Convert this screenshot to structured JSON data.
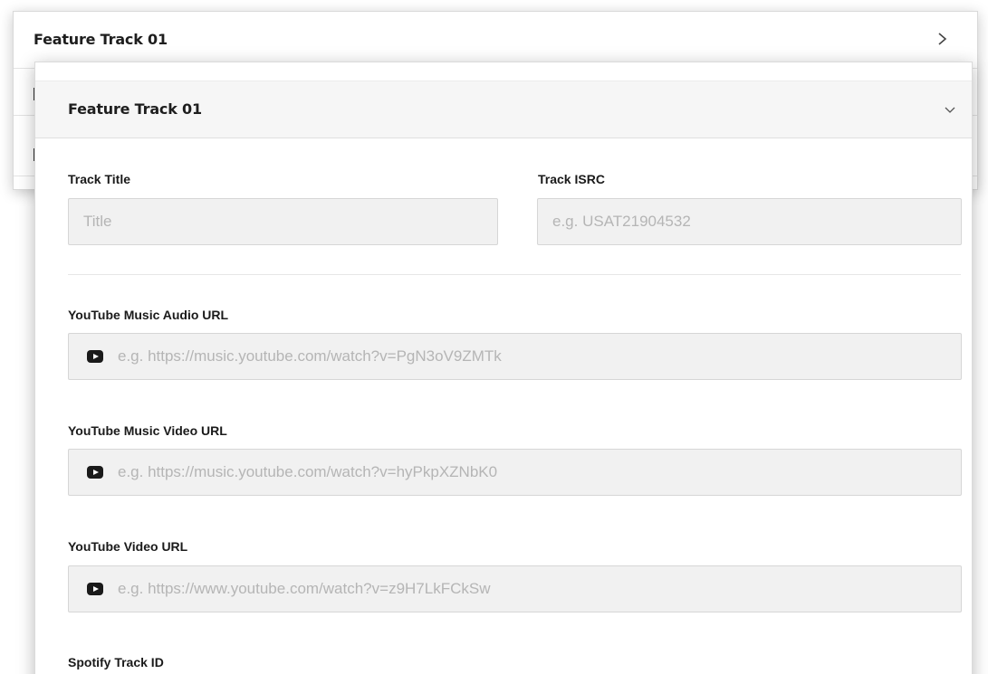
{
  "back_panel": {
    "title": "Feature Track 01"
  },
  "front_panel": {
    "title": "Feature Track 01",
    "track_title": {
      "label": "Track Title",
      "placeholder": "Title"
    },
    "track_isrc": {
      "label": "Track ISRC",
      "placeholder": "e.g. USAT21904532"
    },
    "yt_music_audio": {
      "label": "YouTube Music Audio URL",
      "placeholder": "e.g. https://music.youtube.com/watch?v=PgN3oV9ZMTk",
      "icon": "youtube-icon"
    },
    "yt_music_video": {
      "label": "YouTube Music Video URL",
      "placeholder": "e.g. https://music.youtube.com/watch?v=hyPkpXZNbK0",
      "icon": "youtube-icon"
    },
    "yt_video": {
      "label": "YouTube Video URL",
      "placeholder": "e.g. https://www.youtube.com/watch?v=z9H7LkFCkSw",
      "icon": "youtube-icon"
    },
    "spotify_track": {
      "label": "Spotify Track ID"
    }
  },
  "colors": {
    "header_bg": "#f6f6f6",
    "input_bg": "#f1f1f1",
    "input_border": "#d6d6d6",
    "placeholder": "#b5b5b5",
    "text": "#1a1a1a"
  }
}
